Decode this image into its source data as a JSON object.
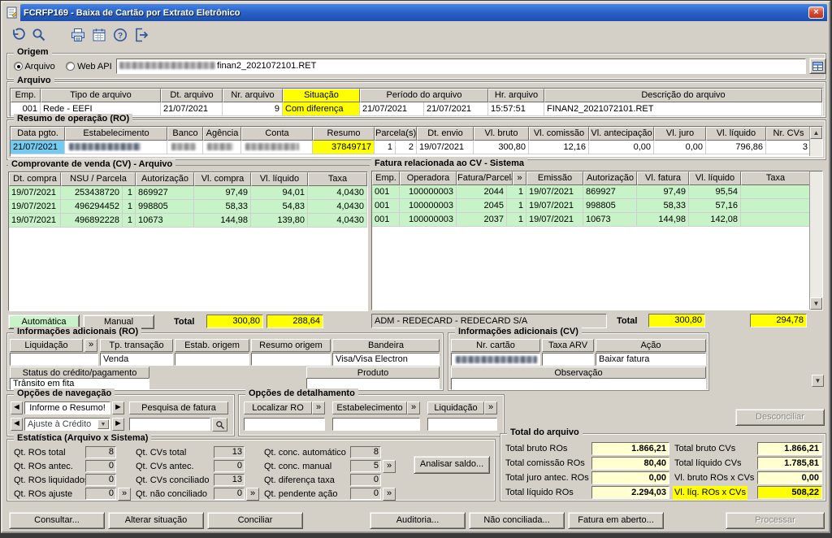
{
  "window": {
    "title": "FCRFP169 - Baixa de Cartão por Extrato Eletrônico"
  },
  "glyphs": {
    "close": "×",
    "more": "»",
    "up": "▲",
    "down": "▼",
    "left": "◄",
    "right": "►",
    "combo": "▼"
  },
  "origem": {
    "label": "Origem",
    "arquivo_radio": "Arquivo",
    "webapi_radio": "Web API",
    "file_suffix": "finan2_2021072101.RET"
  },
  "arquivo": {
    "label": "Arquivo",
    "headers": {
      "emp": "Emp.",
      "tipo": "Tipo de arquivo",
      "dt": "Dt. arquivo",
      "nr": "Nr. arquivo",
      "situacao": "Situação",
      "periodo": "Período do arquivo",
      "hr": "Hr. arquivo",
      "descricao": "Descrição do arquivo"
    },
    "row": {
      "emp": "001",
      "tipo": "Rede - EEFI",
      "dt": "21/07/2021",
      "nr": "9",
      "situacao": "Com diferença",
      "periodo_ini": "21/07/2021",
      "periodo_fim": "21/07/2021",
      "hr": "15:57:51",
      "descricao": "FINAN2_2021072101.RET"
    }
  },
  "resumo": {
    "label": "Resumo de operação (RO)",
    "headers": {
      "data": "Data pgto.",
      "estab": "Estabelecimento",
      "banco": "Banco",
      "agencia": "Agência",
      "conta": "Conta",
      "resumo": "Resumo",
      "parcelas": "Parcela(s)",
      "envio": "Dt. envio",
      "bruto": "Vl. bruto",
      "comissao": "Vl. comissão",
      "antecipacao": "Vl. antecipação",
      "juro": "Vl. juro",
      "liquido": "Vl. líquido",
      "cvs": "Nr. CVs"
    },
    "row": {
      "data": "21/07/2021",
      "resumo": "37849717",
      "parc1": "1",
      "parc2": "2",
      "envio": "19/07/2021",
      "bruto": "300,80",
      "comissao": "12,16",
      "antecipacao": "0,00",
      "juro": "0,00",
      "liquido": "796,86",
      "cvs": "3"
    }
  },
  "cv": {
    "label": "Comprovante de venda (CV) - Arquivo",
    "headers": {
      "dt": "Dt. compra",
      "nsu": "NSU / Parcela",
      "aut": "Autorização",
      "compra": "Vl. compra",
      "liquido": "Vl. líquido",
      "taxa": "Taxa"
    },
    "rows": [
      {
        "dt": "19/07/2021",
        "nsu": "253438720",
        "parc": "1",
        "aut": "869927",
        "compra": "97,49",
        "liquido": "94,01",
        "taxa": "4,0430"
      },
      {
        "dt": "19/07/2021",
        "nsu": "496294452",
        "parc": "1",
        "aut": "998805",
        "compra": "58,33",
        "liquido": "54,83",
        "taxa": "4,0430"
      },
      {
        "dt": "19/07/2021",
        "nsu": "496892228",
        "parc": "1",
        "aut": "10673",
        "compra": "144,98",
        "liquido": "139,80",
        "taxa": "4,0430"
      }
    ],
    "automatica_btn": "Automática",
    "manual_btn": "Manual",
    "total_label": "Total",
    "total_compra": "300,80",
    "total_liquido": "288,64"
  },
  "fatura": {
    "label": "Fatura relacionada ao CV - Sistema",
    "headers": {
      "emp": "Emp.",
      "operadora": "Operadora",
      "fatura": "Fatura/Parcela",
      "more": "»",
      "emissao": "Emissão",
      "aut": "Autorização",
      "vl": "Vl. fatura",
      "liquido": "Vl. líquido",
      "taxa": "Taxa"
    },
    "rows": [
      {
        "emp": "001",
        "operadora": "100000003",
        "fatura": "2044",
        "parc": "1",
        "emissao": "19/07/2021",
        "aut": "869927",
        "vl": "97,49",
        "liquido": "95,54",
        "taxa": ""
      },
      {
        "emp": "001",
        "operadora": "100000003",
        "fatura": "2045",
        "parc": "1",
        "emissao": "19/07/2021",
        "aut": "998805",
        "vl": "58,33",
        "liquido": "57,16",
        "taxa": ""
      },
      {
        "emp": "001",
        "operadora": "100000003",
        "fatura": "2037",
        "parc": "1",
        "emissao": "19/07/2021",
        "aut": "10673",
        "vl": "144,98",
        "liquido": "142,08",
        "taxa": ""
      }
    ],
    "adm": "ADM - REDECARD - REDECARD S/A",
    "total_label": "Total",
    "total_vl": "300,80",
    "total_liquido": "294,78"
  },
  "info_ro": {
    "label": "Informações adicionais (RO)",
    "liquidacao_h": "Liquidação",
    "tp_h": "Tp. transação",
    "estab_h": "Estab. origem",
    "resumo_h": "Resumo origem",
    "bandeira_h": "Bandeira",
    "liquidacao_v": "",
    "tp_v": "Venda",
    "estab_v": "",
    "resumo_v": "",
    "bandeira_v": "Visa/Visa Electron",
    "status_h": "Status do crédito/pagamento",
    "status_v": "Trânsito em fita",
    "produto_h": "Produto",
    "produto_v": ""
  },
  "info_cv": {
    "label": "Informações adicionais (CV)",
    "cartao_h": "Nr. cartão",
    "taxa_h": "Taxa ARV",
    "acao_h": "Ação",
    "taxa_v": "",
    "acao_v": "Baixar fatura",
    "obs_h": "Observação",
    "obs_v": ""
  },
  "navegacao": {
    "label": "Opções de navegação",
    "resumo_box": "Informe o Resumo!",
    "ajuste_combo": "Ajuste à Crédito",
    "pesquisa_h": "Pesquisa de fatura",
    "pesquisa_v": ""
  },
  "detalhamento": {
    "label": "Opções de detalhamento",
    "localizar_h": "Localizar RO",
    "estab_h": "Estabelecimento",
    "liquidacao_h": "Liquidação",
    "localizar_v": "",
    "estab_v": "",
    "liquidacao_v": ""
  },
  "estatistica": {
    "label": "Estatística (Arquivo x Sistema)",
    "items": [
      {
        "label": "Qt. ROs total",
        "value": "8"
      },
      {
        "label": "Qt. CVs total",
        "value": "13"
      },
      {
        "label": "Qt. conc. automático",
        "value": "8"
      },
      {
        "label": "Qt. ROs antec.",
        "value": "0"
      },
      {
        "label": "Qt. CVs antec.",
        "value": "0"
      },
      {
        "label": "Qt. conc. manual",
        "value": "5"
      },
      {
        "label": "Qt. ROs liquidados",
        "value": "0"
      },
      {
        "label": "Qt. CVs conciliado",
        "value": "13"
      },
      {
        "label": "Qt. diferença taxa",
        "value": "0"
      },
      {
        "label": "Qt. ROs ajuste",
        "value": "0"
      },
      {
        "label": "Qt. não conciliado",
        "value": "0"
      },
      {
        "label": "Qt. pendente ação",
        "value": "0"
      }
    ],
    "analisar_btn": "Analisar saldo..."
  },
  "totais": {
    "label": "Total do arquivo",
    "rows": [
      {
        "l1": "Total bruto ROs",
        "v1": "1.866,21",
        "l2": "Total bruto CVs",
        "v2": "1.866,21"
      },
      {
        "l1": "Total comissão ROs",
        "v1": "80,40",
        "l2": "Total líquido CVs",
        "v2": "1.785,81"
      },
      {
        "l1": "Total juro antec. ROs",
        "v1": "0,00",
        "l2": "Vl. bruto ROs x CVs",
        "v2": "0,00"
      },
      {
        "l1": "Total líquido ROs",
        "v1": "2.294,03",
        "l2": "Vl. líq. ROs x CVs",
        "v2": "508,22"
      }
    ]
  },
  "actions": {
    "desconciliar": "Desconciliar",
    "consultar": "Consultar...",
    "alterar": "Alterar situação",
    "conciliar": "Conciliar",
    "auditoria": "Auditoria...",
    "nao_conciliada": "Não conciliada...",
    "fatura_aberto": "Fatura em aberto...",
    "processar": "Processar"
  },
  "colors": {
    "highlight": "#ffff00",
    "row_green": "#c8f2c8",
    "selected": "#73cbf2"
  }
}
